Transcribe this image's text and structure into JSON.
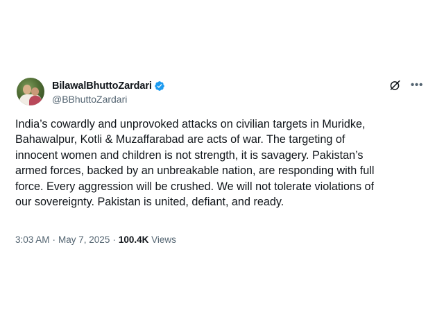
{
  "post": {
    "display_name": "BilawalBhuttoZardari",
    "handle": "@BBhuttoZardari",
    "verified": true,
    "lines": [
      "India’s cowardly and unprovoked attacks on civilian targets in Muridke,",
      "Bahawalpur, Kotli & Muzaffarabad are acts of war. The targeting of",
      "innocent women and children is not strength, it is savagery. Pakistan’s",
      "armed forces, backed by an unbreakable nation, are responding with full",
      "force. Every aggression will be crushed. We will not tolerate violations of",
      "our sovereignty. Pakistan is united, defiant, and ready."
    ],
    "time": "3:03 AM",
    "separator": "·",
    "date": "May 7, 2025",
    "views_count": "100.4K",
    "views_label": "Views"
  },
  "icons": {
    "verified": "verified-badge-icon",
    "grok": "grok-icon",
    "more": "more-options-icon"
  },
  "colors": {
    "text_primary": "#0f1419",
    "text_secondary": "#536471",
    "verified_blue": "#1d9bf0"
  }
}
